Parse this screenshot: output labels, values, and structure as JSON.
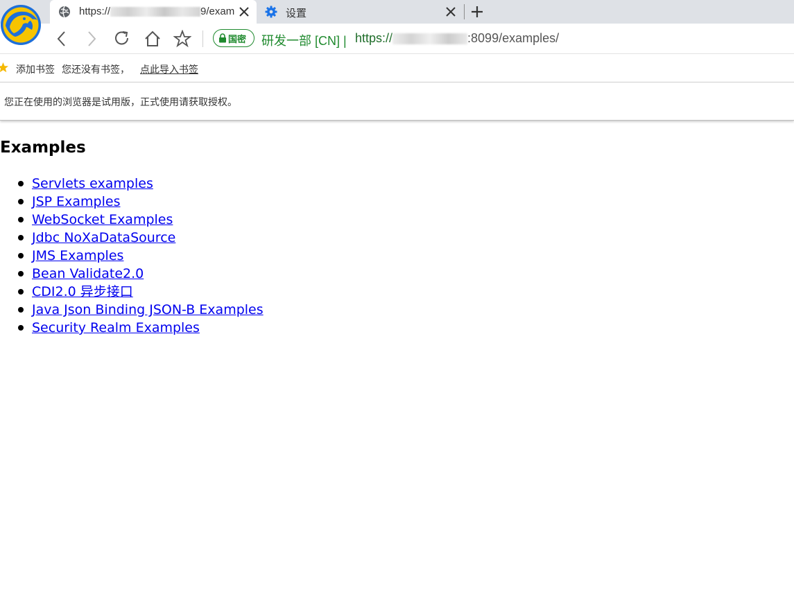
{
  "tabs": [
    {
      "title_prefix": "https://",
      "title_suffix": "9/exam",
      "icon": "globe-icon",
      "active": true
    },
    {
      "title": "设置",
      "icon": "gear-icon",
      "active": false
    }
  ],
  "toolbar": {
    "secure_badge": "国密",
    "org_name": "研发一部 [CN] |",
    "url_prefix": "https://",
    "url_suffix": ":8099/examples/"
  },
  "bookmarks": {
    "add_label": "添加书签",
    "empty_text": "您还没有书签，",
    "import_link": "点此导入书签"
  },
  "infobar": {
    "message": "您正在使用的浏览器是试用版，正式使用请获取授权。"
  },
  "page": {
    "title": "Examples",
    "links": [
      "Servlets examples",
      "JSP Examples",
      "WebSocket Examples",
      "Jdbc NoXaDataSource",
      "JMS Examples",
      "Bean Validate2.0",
      "CDI2.0 异步接口",
      "Java Json Binding JSON-B Examples",
      "Security Realm Examples"
    ]
  },
  "colors": {
    "secure_green": "#1f8a2e",
    "link_blue": "#0000ee",
    "tabstrip_gray": "#dee1e6"
  }
}
